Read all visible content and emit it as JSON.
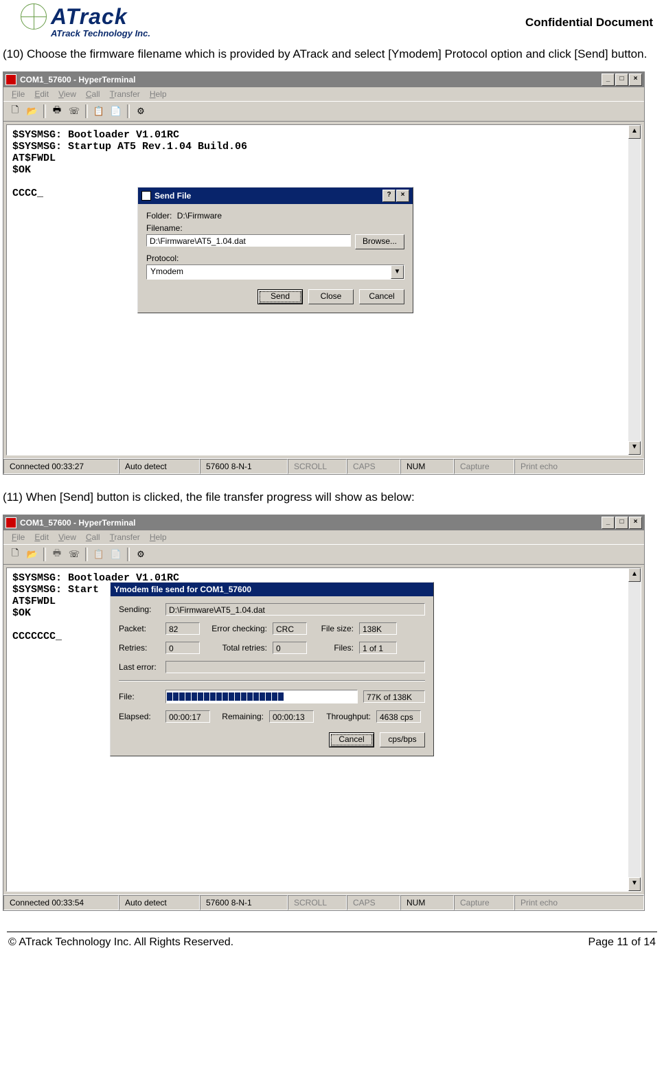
{
  "header": {
    "logo_main": "ATrack",
    "logo_sub": "ATrack Technology Inc.",
    "confidential": "Confidential Document"
  },
  "instruction10": "(10) Choose the firmware filename which is provided by ATrack and select [Ymodem] Protocol option and click [Send] button.",
  "instruction11": "(11) When [Send] button is clicked, the file transfer progress will show as below:",
  "hyperterminal": {
    "title": "COM1_57600 - HyperTerminal",
    "menu": [
      "File",
      "Edit",
      "View",
      "Call",
      "Transfer",
      "Help"
    ],
    "toolbar_icons": [
      "new-file-icon",
      "open-folder-icon",
      "print-icon",
      "phone-icon",
      "copy-icon",
      "paste-icon",
      "properties-icon"
    ]
  },
  "terminal1_text": "$SYSMSG: Bootloader V1.01RC\n$SYSMSG: Startup AT5 Rev.1.04 Build.06\nAT$FWDL\n$OK\n\nCCCC_",
  "terminal2_text": "$SYSMSG: Bootloader V1.01RC\n$SYSMSG: Start\nAT$FWDL\n$OK\n\nCCCCCCC_",
  "send_file_dialog": {
    "title": "Send File",
    "folder_label": "Folder:",
    "folder_value": "D:\\Firmware",
    "filename_label": "Filename:",
    "filename_value": "D:\\Firmware\\AT5_1.04.dat",
    "browse": "Browse...",
    "protocol_label": "Protocol:",
    "protocol_value": "Ymodem",
    "send": "Send",
    "close": "Close",
    "cancel": "Cancel"
  },
  "progress_dialog": {
    "title": "Ymodem file send for COM1_57600",
    "sending_label": "Sending:",
    "sending_value": "D:\\Firmware\\AT5_1.04.dat",
    "packet_label": "Packet:",
    "packet_value": "82",
    "error_checking_label": "Error checking:",
    "error_checking_value": "CRC",
    "file_size_label": "File size:",
    "file_size_value": "138K",
    "retries_label": "Retries:",
    "retries_value": "0",
    "total_retries_label": "Total retries:",
    "total_retries_value": "0",
    "files_label": "Files:",
    "files_value": "1 of 1",
    "last_error_label": "Last error:",
    "last_error_value": "",
    "file_label": "File:",
    "file_progress_text": "77K of 138K",
    "progress_segments": 19,
    "elapsed_label": "Elapsed:",
    "elapsed_value": "00:00:17",
    "remaining_label": "Remaining:",
    "remaining_value": "00:00:13",
    "throughput_label": "Throughput:",
    "throughput_value": "4638 cps",
    "cancel": "Cancel",
    "cpsbps": "cps/bps"
  },
  "status1": {
    "connected": "Connected 00:33:27",
    "detect": "Auto detect",
    "conn": "57600 8-N-1",
    "scroll": "SCROLL",
    "caps": "CAPS",
    "num": "NUM",
    "capture": "Capture",
    "print": "Print echo"
  },
  "status2": {
    "connected": "Connected 00:33:54",
    "detect": "Auto detect",
    "conn": "57600 8-N-1",
    "scroll": "SCROLL",
    "caps": "CAPS",
    "num": "NUM",
    "capture": "Capture",
    "print": "Print echo"
  },
  "footer": {
    "copyright": "© ATrack Technology Inc. All Rights Reserved.",
    "page": "Page 11 of 14"
  }
}
